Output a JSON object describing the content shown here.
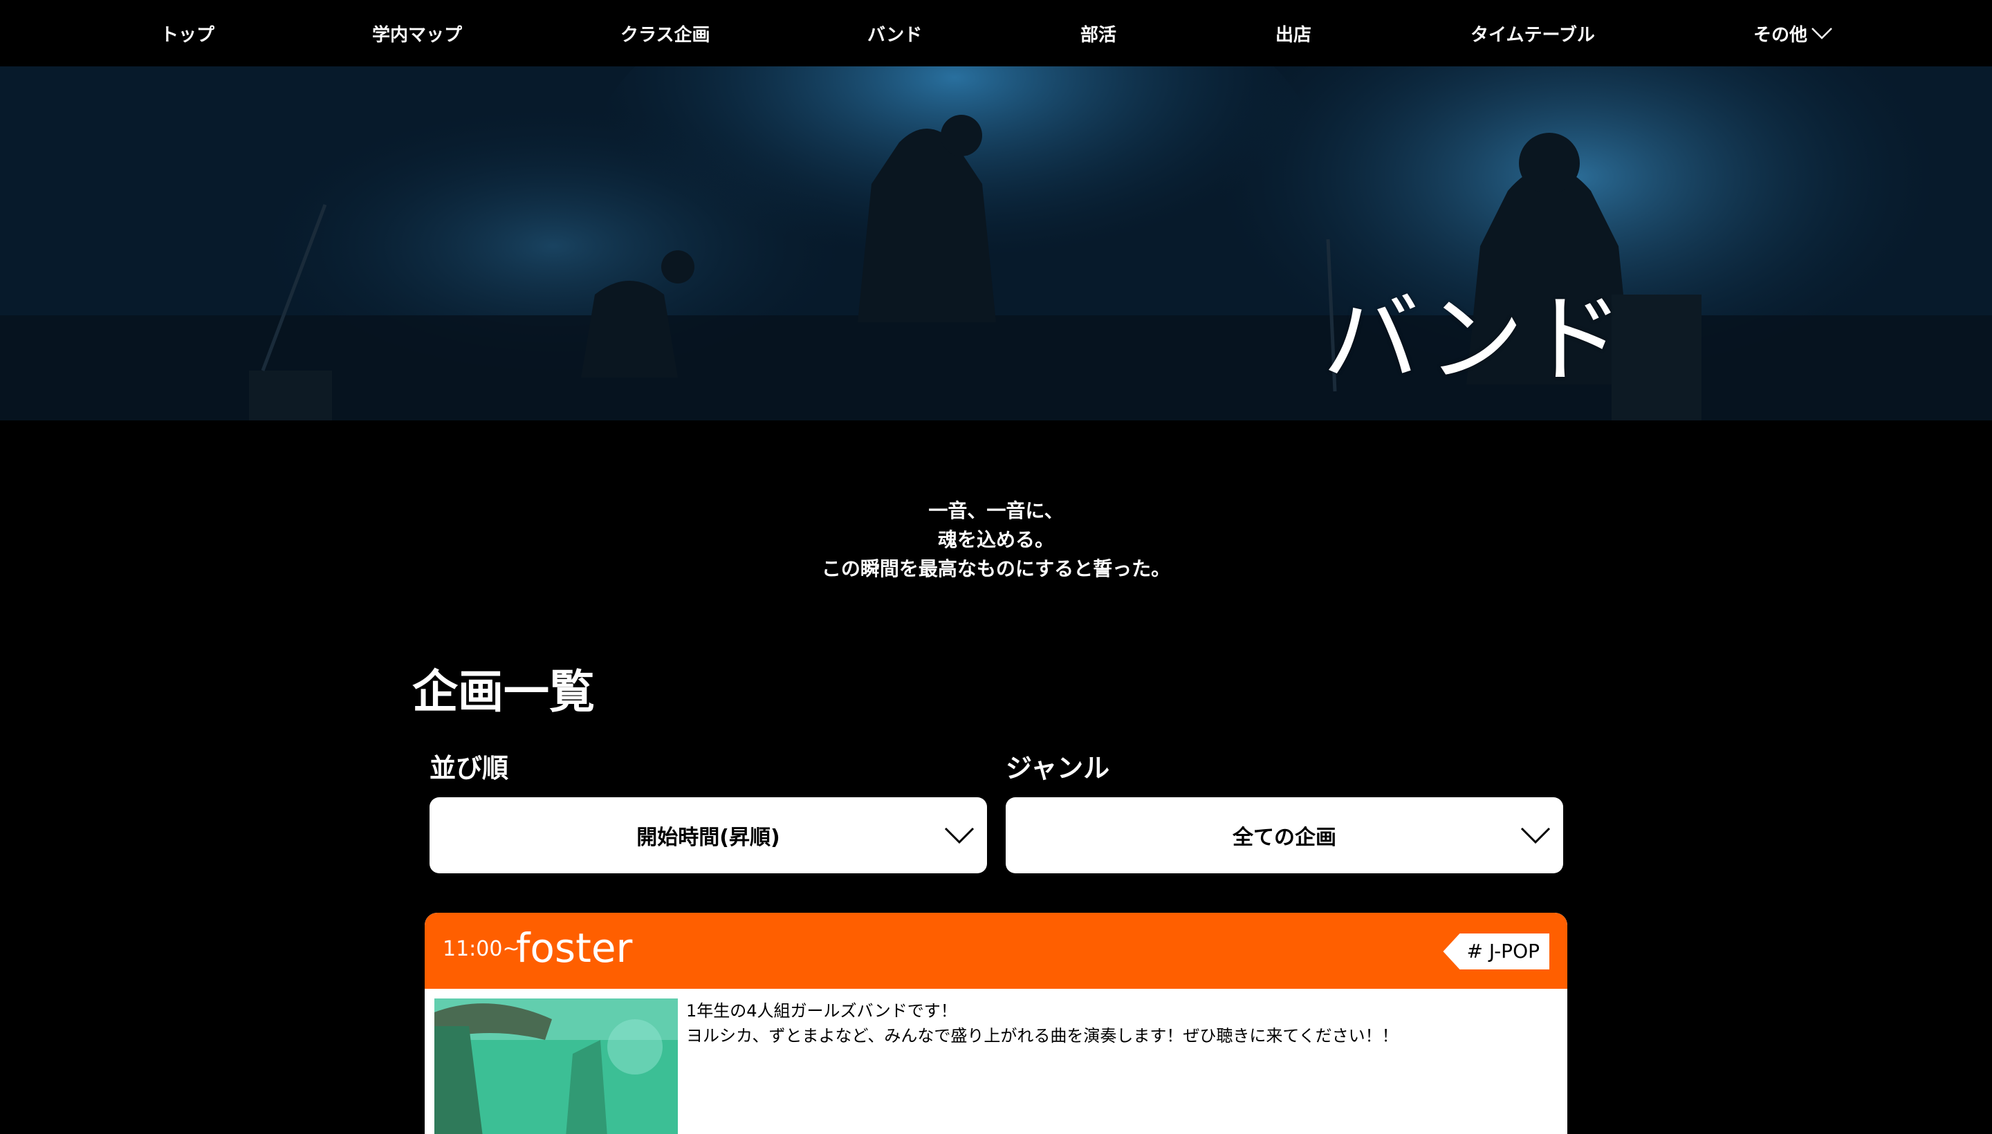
{
  "nav": {
    "items": [
      {
        "label": "トップ"
      },
      {
        "label": "学内マップ"
      },
      {
        "label": "クラス企画"
      },
      {
        "label": "バンド"
      },
      {
        "label": "部活"
      },
      {
        "label": "出店"
      },
      {
        "label": "タイムテーブル"
      },
      {
        "label": "その他"
      }
    ],
    "more_icon": "chevron-down-icon"
  },
  "hero": {
    "title": "バンド"
  },
  "intro": {
    "lines": [
      "一音、一音に、",
      "魂を込める。",
      "この瞬間を最高なものにすると誓った。"
    ]
  },
  "list": {
    "title": "企画一覧",
    "sort": {
      "label": "並び順",
      "selected": "開始時間(昇順)"
    },
    "genre": {
      "label": "ジャンル",
      "selected": "全ての企画"
    }
  },
  "events": [
    {
      "time": "11:00~",
      "name": "foster",
      "tag": "# J-POP",
      "description": [
        "1年生の4人組ガールズバンドです！",
        "ヨルシカ、ずとまよなど、みんなで盛り上がれる曲を演奏します！ぜひ聴きに来てください！！"
      ]
    }
  ],
  "colors": {
    "background": "#000000",
    "accent": "#ff5f00",
    "text": "#ffffff"
  }
}
